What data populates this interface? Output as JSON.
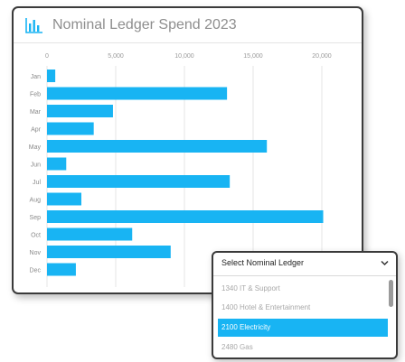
{
  "card": {
    "title": "Nominal Ledger Spend 2023",
    "icon": "bar-chart-icon"
  },
  "chart_data": {
    "type": "bar",
    "orientation": "horizontal",
    "color": "#18b4f3",
    "categories": [
      "Jan",
      "Feb",
      "Mar",
      "Apr",
      "May",
      "Jun",
      "Jul",
      "Aug",
      "Sep",
      "Oct",
      "Nov",
      "Dec"
    ],
    "values": [
      600,
      13100,
      4800,
      3400,
      16000,
      1400,
      13300,
      2500,
      20100,
      6200,
      9000,
      2100
    ],
    "xticks": [
      "0",
      "5,000",
      "10,000",
      "15,000",
      "20,000"
    ],
    "xlim": [
      0,
      20000
    ],
    "grid": true
  },
  "dropdown": {
    "label": "Select Nominal Ledger",
    "options": [
      {
        "label": "1340 IT & Support",
        "selected": false
      },
      {
        "label": "1400 Hotel & Entertainment",
        "selected": false
      },
      {
        "label": "2100 Electricity",
        "selected": true
      },
      {
        "label": "2480 Gas",
        "selected": false
      }
    ],
    "selected_color": "#18b4f3"
  }
}
